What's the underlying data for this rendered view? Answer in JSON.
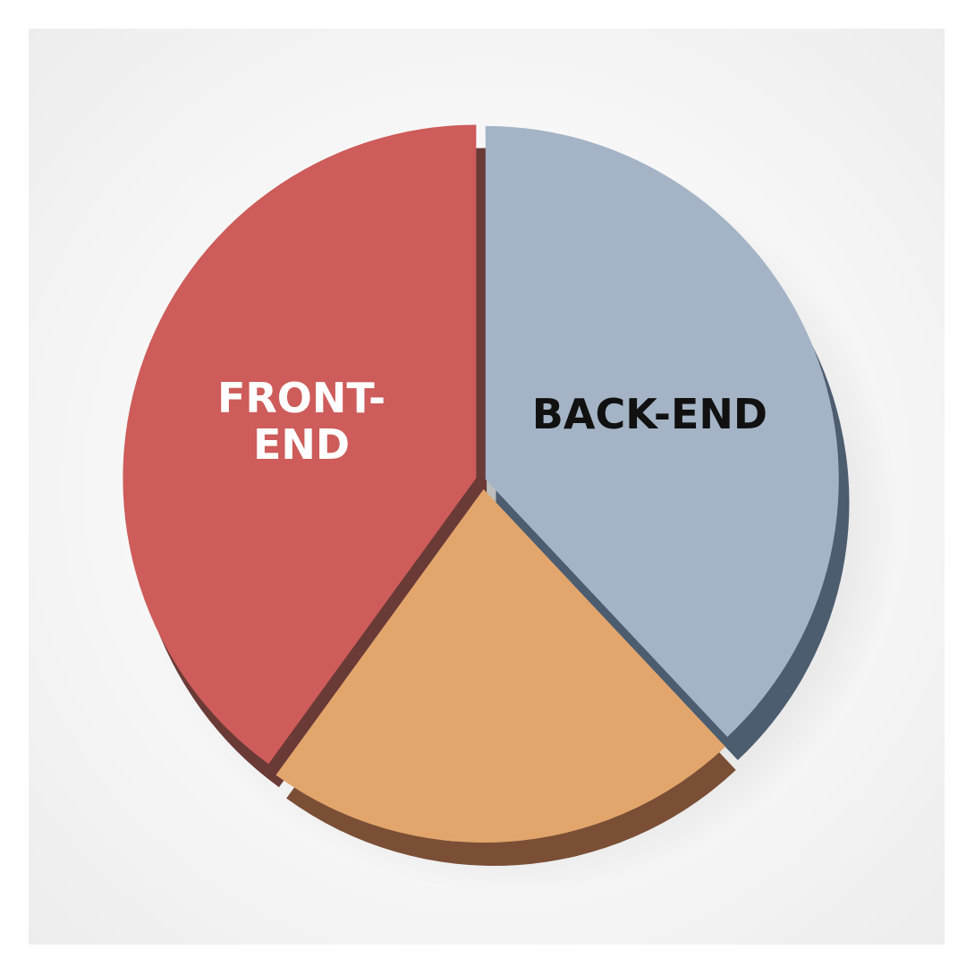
{
  "chart_data": {
    "type": "pie",
    "style": "3d-extruded",
    "legend": "none",
    "slices": [
      {
        "label_lines": [
          "FRONT-",
          "END"
        ],
        "value": 40,
        "color": "#cd5c5a",
        "side_color": "#6a3a36",
        "label_color": "#ffffff"
      },
      {
        "label_lines": [
          "BACK-END"
        ],
        "value": 38,
        "color": "#a4b4c6",
        "side_color": "#4d5d70",
        "label_color": "#111111"
      },
      {
        "label_lines": [],
        "value": 22,
        "color": "#e2a66c",
        "side_color": "#7a4f36",
        "label_color": "#111111"
      }
    ]
  }
}
